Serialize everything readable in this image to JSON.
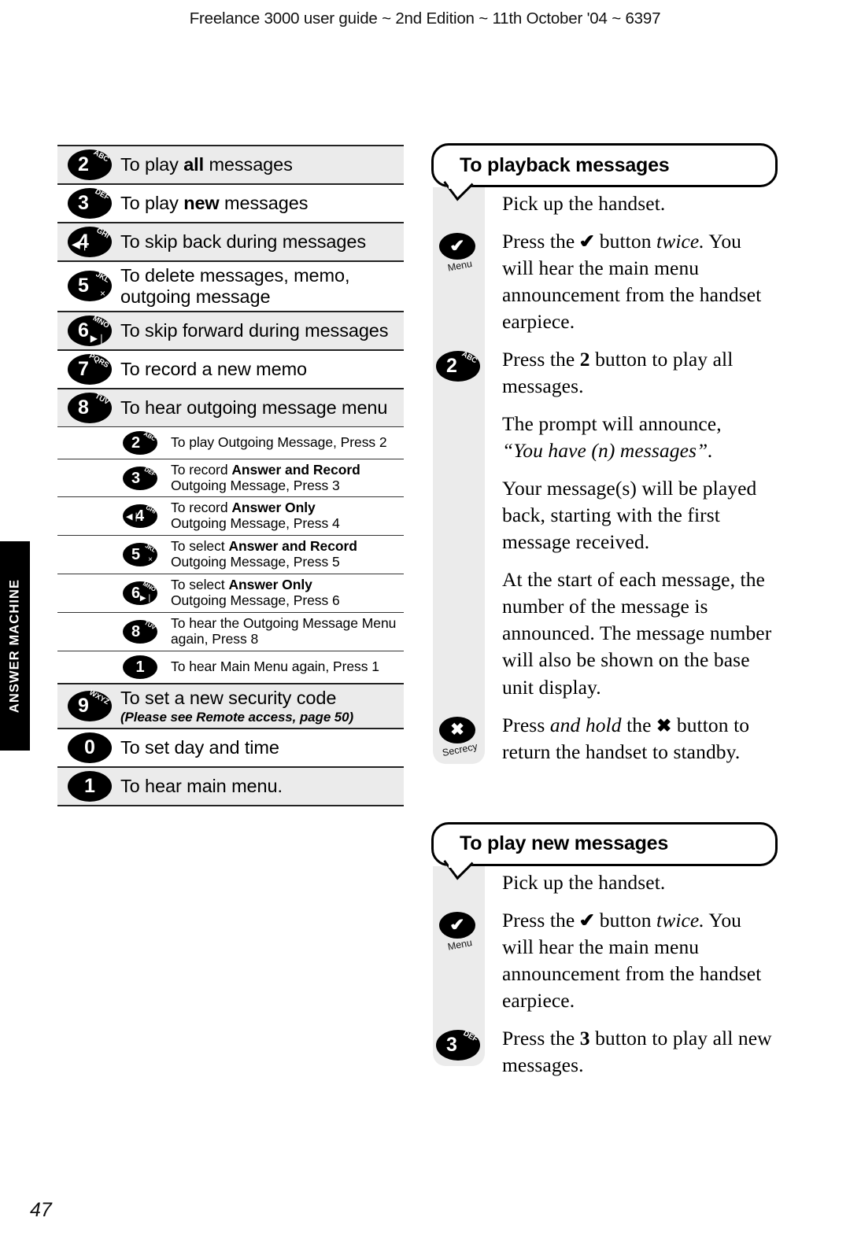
{
  "running_head": "Freelance 3000 user guide ~ 2nd Edition ~ 11th October '04 ~ 6397",
  "page_number": "47",
  "thumb_tab": {
    "label": "ANSWER MACHINE"
  },
  "key_list": {
    "rows": [
      {
        "level": "top",
        "shaded": true,
        "key": {
          "digit": "2",
          "letters": "ABC"
        },
        "text_html": "To play <b>all</b> messages"
      },
      {
        "level": "top",
        "shaded": false,
        "key": {
          "digit": "3",
          "letters": "DEF"
        },
        "text_html": "To play <b>new</b> messages"
      },
      {
        "level": "top",
        "shaded": true,
        "key": {
          "digit": "4",
          "letters": "GHI",
          "sym_left": "skip-back"
        },
        "text_html": "To skip back during messages"
      },
      {
        "level": "top",
        "shaded": false,
        "key": {
          "digit": "5",
          "letters": "JKL",
          "sym_sub": "delete-x"
        },
        "text_html": "To delete messages, memo,<br>outgoing message"
      },
      {
        "level": "top",
        "shaded": true,
        "key": {
          "digit": "6",
          "letters": "MNO",
          "sym_sub": "skip-forward"
        },
        "text_html": "To skip forward during messages"
      },
      {
        "level": "top",
        "shaded": false,
        "key": {
          "digit": "7",
          "letters": "PQRS"
        },
        "text_html": "To record a new memo"
      },
      {
        "level": "top",
        "shaded": true,
        "key": {
          "digit": "8",
          "letters": "TUV"
        },
        "text_html": "To hear outgoing message menu"
      },
      {
        "level": "sub",
        "shaded": false,
        "key": {
          "digit": "2",
          "letters": "ABC"
        },
        "text_html": "To play Outgoing Message, Press 2"
      },
      {
        "level": "sub",
        "shaded": false,
        "key": {
          "digit": "3",
          "letters": "DEF"
        },
        "text_html": "To record <b>Answer and Record</b><br>Outgoing Message, Press 3"
      },
      {
        "level": "sub",
        "shaded": false,
        "key": {
          "digit": "4",
          "letters": "GHI",
          "sym_left": "skip-back"
        },
        "text_html": "To record <b>Answer Only</b><br>Outgoing Message, Press 4"
      },
      {
        "level": "sub",
        "shaded": false,
        "key": {
          "digit": "5",
          "letters": "JKL",
          "sym_sub": "delete-x"
        },
        "text_html": "To select <b>Answer and Record</b><br>Outgoing Message, Press 5"
      },
      {
        "level": "sub",
        "shaded": false,
        "key": {
          "digit": "6",
          "letters": "MNO",
          "sym_sub": "skip-forward"
        },
        "text_html": "To select <b>Answer Only</b><br>Outgoing Message, Press 6"
      },
      {
        "level": "sub",
        "shaded": false,
        "key": {
          "digit": "8",
          "letters": "TUV"
        },
        "text_html": "To hear the Outgoing Message Menu<br>again, Press 8"
      },
      {
        "level": "sub",
        "shaded": false,
        "key": {
          "digit": "1",
          "letters": ""
        },
        "text_html": "To hear Main Menu again, Press 1"
      },
      {
        "level": "top",
        "shaded": true,
        "key": {
          "digit": "9",
          "letters": "WXYZ"
        },
        "text_html": "To set a new security code<span class=\"note\">(Please see Remote access, page 50)</span>"
      },
      {
        "level": "top",
        "shaded": false,
        "key": {
          "digit": "0",
          "letters": ""
        },
        "text_html": "To set day and time"
      },
      {
        "level": "top",
        "shaded": true,
        "last": true,
        "key": {
          "digit": "1",
          "letters": ""
        },
        "text_html": "To hear main menu."
      }
    ]
  },
  "panels": [
    {
      "title": "To playback messages",
      "steps": [
        {
          "icon": null,
          "text_html": "Pick up the handset."
        },
        {
          "icon": {
            "type": "menu-check",
            "caption": "Menu"
          },
          "text_html": "Press the <span class=\"glyph-check\">&#10004;</span> button <i>twice.</i> You will hear the main menu announcement from the handset earpiece."
        },
        {
          "icon": {
            "type": "keycap",
            "digit": "2",
            "letters": "ABC"
          },
          "text_html": "Press the <b>2</b> button to play all messages."
        },
        {
          "icon": null,
          "text_html": "The prompt will announce,<br><i>&#8220;You have (n) messages&#8221;.</i>"
        },
        {
          "icon": null,
          "text_html": "Your message(s) will be played back, starting with the first message received."
        },
        {
          "icon": null,
          "text_html": "At the start of each message, the number of the message is announced. The message number will also be shown on the base unit display."
        },
        {
          "icon": {
            "type": "secrecy-x",
            "caption": "Secrecy"
          },
          "text_html": "Press <i>and hold</i> the <span class=\"glyph-x\">&#10006;</span> button to return the handset to standby."
        }
      ]
    },
    {
      "title": "To play new messages",
      "steps": [
        {
          "icon": null,
          "text_html": "Pick up the handset."
        },
        {
          "icon": {
            "type": "menu-check",
            "caption": "Menu"
          },
          "text_html": "Press the <span class=\"glyph-check\">&#10004;</span> button <i>twice.</i> You will hear the main menu announcement from the handset earpiece."
        },
        {
          "icon": {
            "type": "keycap",
            "digit": "3",
            "letters": "DEF"
          },
          "text_html": "Press the <b>3</b> button to play all new messages."
        }
      ]
    }
  ],
  "symbols": {
    "skip-back": "◀❘",
    "skip-forward": "▶❘",
    "delete-x": "×"
  },
  "colors": {
    "shade": "#ebebeb",
    "rule": "#222222",
    "ink": "#000000"
  }
}
